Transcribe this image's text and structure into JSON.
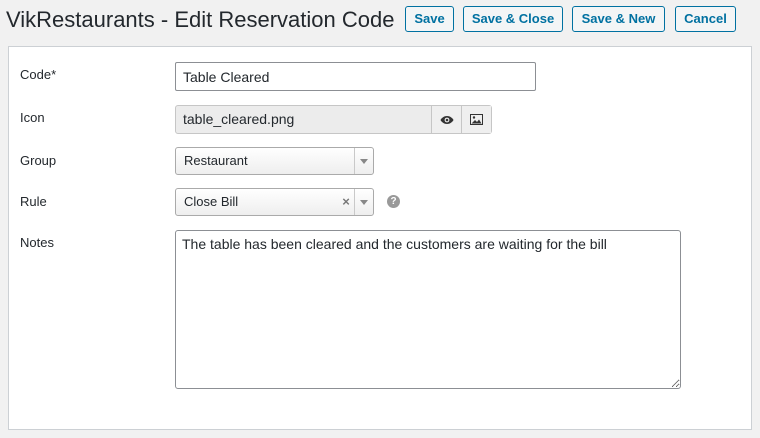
{
  "page_title": "VikRestaurants - Edit Reservation Code",
  "toolbar": {
    "save_label": "Save",
    "save_close_label": "Save & Close",
    "save_new_label": "Save & New",
    "cancel_label": "Cancel"
  },
  "form": {
    "code": {
      "label": "Code*",
      "value": "Table Cleared"
    },
    "icon": {
      "label": "Icon",
      "value": "table_cleared.png",
      "preview_icon": "eye-icon",
      "browse_icon": "image-icon"
    },
    "group": {
      "label": "Group",
      "value": "Restaurant"
    },
    "rule": {
      "label": "Rule",
      "value": "Close Bill",
      "clear_glyph": "×",
      "help_icon": "question-circle-icon",
      "help_glyph": "?"
    },
    "notes": {
      "label": "Notes",
      "value": "The table has been cleared and the customers are waiting for the bill"
    }
  },
  "colors": {
    "accent": "#0071a1",
    "background": "#f1f1f1",
    "panel": "#ffffff"
  }
}
